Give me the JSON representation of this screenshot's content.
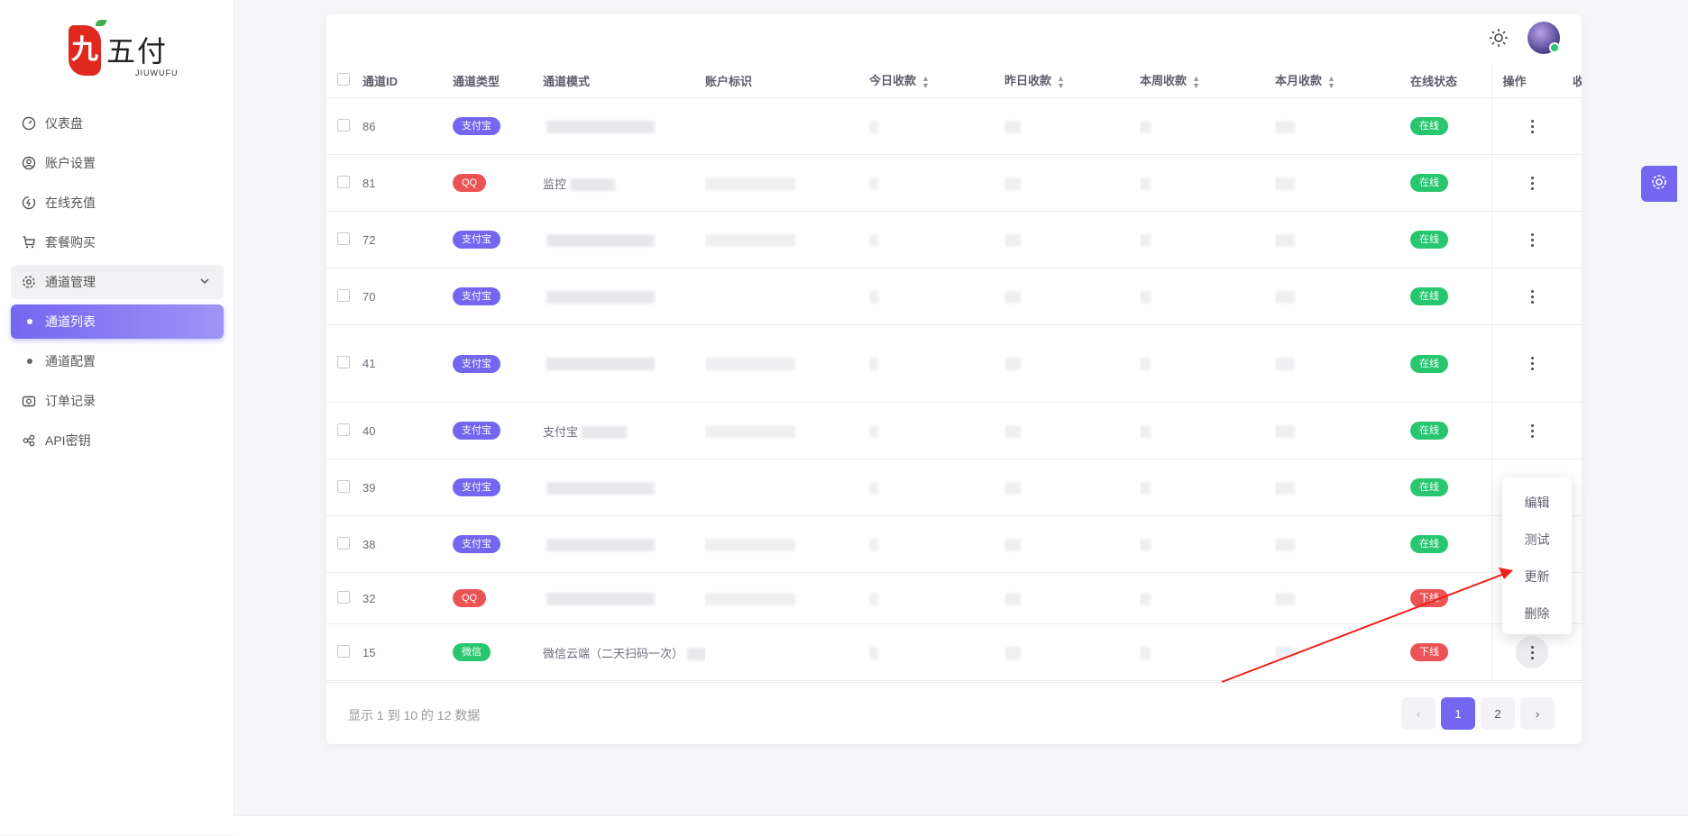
{
  "brand": {
    "logo_char": "九",
    "name": "五付",
    "sub": "JIUWUFU"
  },
  "sidebar": {
    "items": [
      {
        "label": "仪表盘",
        "icon": "dashboard-icon"
      },
      {
        "label": "账户设置",
        "icon": "user-circle-icon"
      },
      {
        "label": "在线充值",
        "icon": "charge-icon"
      },
      {
        "label": "套餐购买",
        "icon": "cart-icon"
      }
    ],
    "group": {
      "label": "通道管理",
      "icon": "channel-settings-icon"
    },
    "subitems": [
      {
        "label": "通道列表",
        "active": true
      },
      {
        "label": "通道配置",
        "active": false
      }
    ],
    "items_after": [
      {
        "label": "订单记录",
        "icon": "camera-icon"
      },
      {
        "label": "API密钥",
        "icon": "api-icon"
      }
    ]
  },
  "table": {
    "headers": {
      "id": "通道ID",
      "type": "通道类型",
      "mode": "通道模式",
      "account": "账户标识",
      "today": "今日收款",
      "yesterday": "昨日收款",
      "week": "本周收款",
      "month": "本月收款",
      "status": "在线状态",
      "ops": "操作",
      "extra": "收"
    },
    "rows": [
      {
        "id": "86",
        "type": "支付宝",
        "type_kind": "ali",
        "mode": "",
        "status": "在线",
        "status_kind": "on"
      },
      {
        "id": "81",
        "type": "QQ",
        "type_kind": "qq",
        "mode": "监控",
        "status": "在线",
        "status_kind": "on"
      },
      {
        "id": "72",
        "type": "支付宝",
        "type_kind": "ali",
        "mode": "",
        "status": "在线",
        "status_kind": "on"
      },
      {
        "id": "70",
        "type": "支付宝",
        "type_kind": "ali",
        "mode": "",
        "status": "在线",
        "status_kind": "on"
      },
      {
        "id": "41",
        "type": "支付宝",
        "type_kind": "ali",
        "mode": "",
        "status": "在线",
        "status_kind": "on"
      },
      {
        "id": "40",
        "type": "支付宝",
        "type_kind": "ali",
        "mode": "支付宝",
        "status": "在线",
        "status_kind": "on"
      },
      {
        "id": "39",
        "type": "支付宝",
        "type_kind": "ali",
        "mode": "",
        "status": "在线",
        "status_kind": "on"
      },
      {
        "id": "38",
        "type": "支付宝",
        "type_kind": "ali",
        "mode": "",
        "status": "在线",
        "status_kind": "on"
      },
      {
        "id": "32",
        "type": "QQ",
        "type_kind": "qq",
        "mode": "",
        "status": "下线",
        "status_kind": "off"
      },
      {
        "id": "15",
        "type": "微信",
        "type_kind": "wx",
        "mode": "微信云端（二天扫码一次）",
        "status": "下线",
        "status_kind": "off"
      }
    ]
  },
  "dropdown": {
    "items": [
      "编辑",
      "测试",
      "更新",
      "删除"
    ]
  },
  "footer": {
    "info": "显示 1 到 10 的 12 数据",
    "pages": [
      "1",
      "2"
    ],
    "prev": "‹",
    "next": "›"
  },
  "colors": {
    "accent": "#7367f0",
    "success": "#28c76f",
    "danger": "#ea5455"
  }
}
